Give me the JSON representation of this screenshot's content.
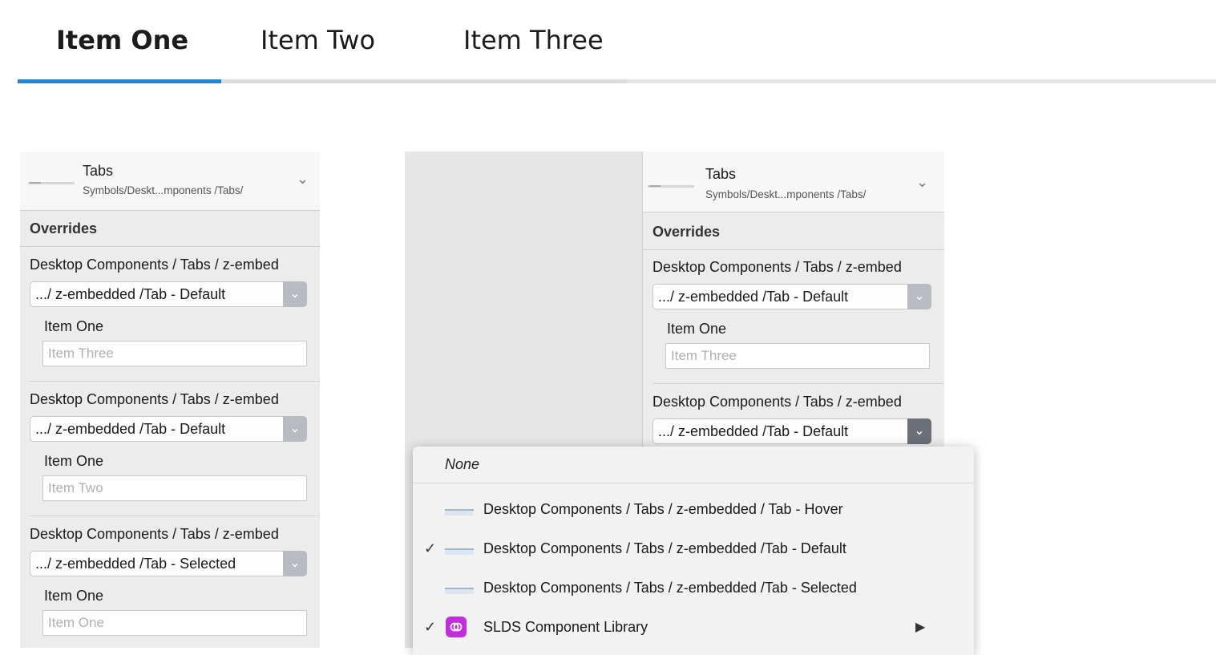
{
  "tabs": [
    "Item One",
    "Item Two",
    "Item Three"
  ],
  "left_panel": {
    "title": "Tabs",
    "subtitle": "Symbols/Deskt...mponents /Tabs/",
    "overrides_label": "Overrides",
    "groups": [
      {
        "title": "Desktop Components / Tabs / z-embed",
        "select_value": ".../ z-embedded /Tab - Default",
        "field_label": "Item One",
        "field_placeholder": "Item Three"
      },
      {
        "title": "Desktop Components / Tabs / z-embed",
        "select_value": ".../ z-embedded /Tab - Default",
        "field_label": "Item One",
        "field_placeholder": "Item Two"
      },
      {
        "title": "Desktop Components / Tabs / z-embed",
        "select_value": ".../ z-embedded /Tab - Selected",
        "field_label": "Item One",
        "field_placeholder": "Item One"
      }
    ]
  },
  "right_panel": {
    "title": "Tabs",
    "subtitle": "Symbols/Deskt...mponents /Tabs/",
    "overrides_label": "Overrides",
    "groups": [
      {
        "title": "Desktop Components / Tabs / z-embed",
        "select_value": ".../ z-embedded /Tab - Default",
        "field_label": "Item One",
        "field_placeholder": "Item Three"
      },
      {
        "title": "Desktop Components / Tabs / z-embed",
        "select_value": ".../ z-embedded /Tab - Default"
      }
    ]
  },
  "menu": {
    "none_label": "None",
    "items": [
      {
        "label": "Desktop Components / Tabs / z-embedded / Tab - Hover",
        "checked": false
      },
      {
        "label": "Desktop Components / Tabs / z-embedded /Tab - Default",
        "checked": true
      },
      {
        "label": "Desktop Components / Tabs / z-embedded /Tab - Selected",
        "checked": false
      },
      {
        "label": "SLDS Component Library",
        "checked": true,
        "submenu": true
      }
    ],
    "check_glyph": "✓",
    "submenu_arrow": "▶"
  },
  "icons": {
    "chevron": "chevron-down-icon",
    "library": "slds-library-icon",
    "accent_color": "#1b86dc",
    "library_color": "#c42be0"
  }
}
